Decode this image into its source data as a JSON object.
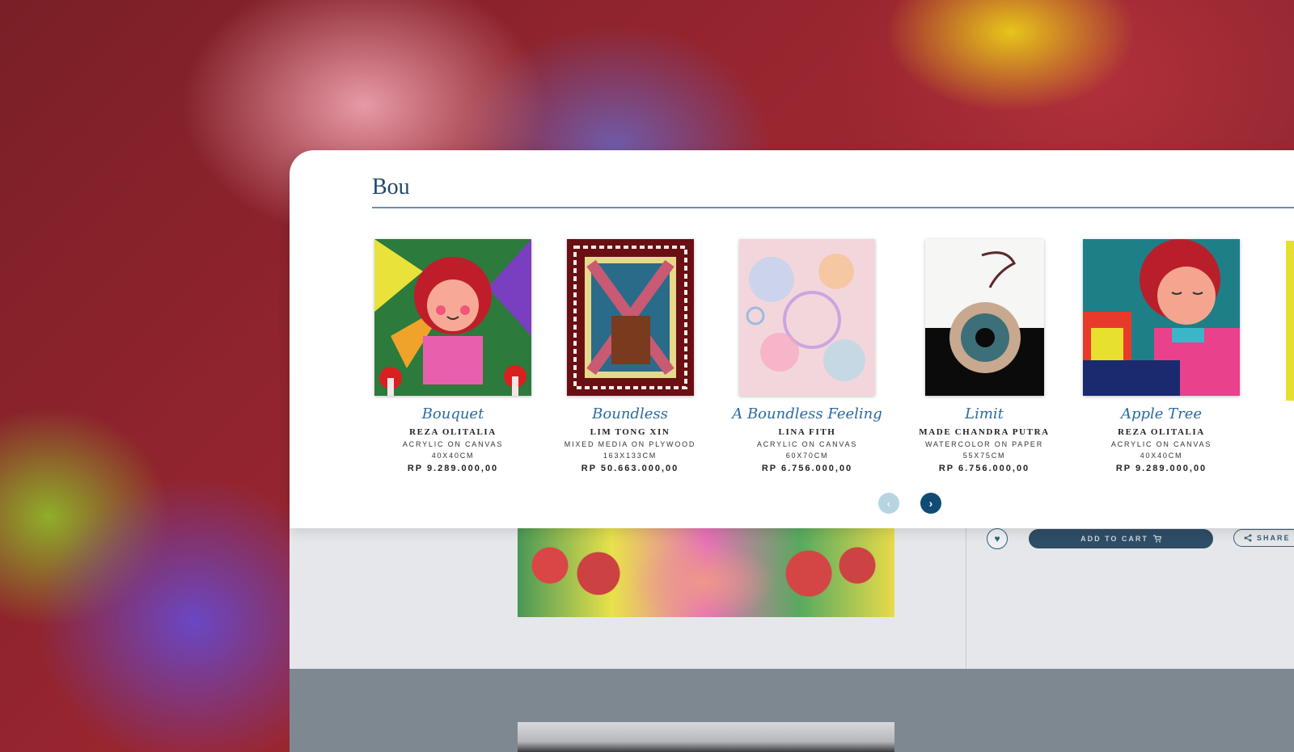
{
  "search": {
    "query": "Bou"
  },
  "results": [
    {
      "title": "Bouquet",
      "artist": "REZA OLITALIA",
      "medium": "ACRYLIC ON CANVAS",
      "size": "40X40CM",
      "price": "RP 9.289.000,00"
    },
    {
      "title": "Boundless",
      "artist": "LIM TONG XIN",
      "medium": "MIXED MEDIA ON PLYWOOD",
      "size": "163X133CM",
      "price": "RP 50.663.000,00"
    },
    {
      "title": "A Boundless Feeling",
      "artist": "LINA FITH",
      "medium": "ACRYLIC ON CANVAS",
      "size": "60X70CM",
      "price": "RP 6.756.000,00"
    },
    {
      "title": "Limit",
      "artist": "MADE CHANDRA PUTRA",
      "medium": "WATERCOLOR ON PAPER",
      "size": "55X75CM",
      "price": "RP 6.756.000,00"
    },
    {
      "title": "Apple Tree",
      "artist": "REZA OLITALIA",
      "medium": "ACRYLIC ON CANVAS",
      "size": "40X40CM",
      "price": "RP 9.289.000,00"
    }
  ],
  "carousel": {
    "prev_icon": "chevron-left-icon",
    "next_icon": "chevron-right-icon"
  },
  "product_actions": {
    "add_to_cart": "ADD TO CART",
    "share": "SHARE",
    "wishlist_icon": "heart-icon",
    "cart_icon": "cart-icon",
    "share_icon": "share-icon"
  },
  "colors": {
    "accent": "#104b73",
    "title_script": "#2c6aa0"
  }
}
